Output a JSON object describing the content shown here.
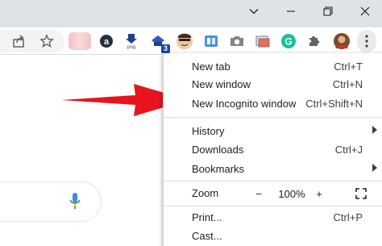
{
  "window_controls": {
    "dropdown_icon": "chevron-down-icon",
    "minimize_icon": "minimize-icon",
    "restore_icon": "restore-icon",
    "close_icon": "close-icon"
  },
  "toolbar": {
    "share_icon": "share-icon",
    "bookmark_icon": "star-icon",
    "extensions": [
      {
        "name": "amazon-assistant-icon"
      },
      {
        "name": "download-png-icon",
        "text": "png"
      },
      {
        "name": "extension-badge-icon",
        "badge": "3"
      },
      {
        "name": "avatar-extension-icon"
      },
      {
        "name": "reader-icon"
      },
      {
        "name": "camera-icon"
      },
      {
        "name": "screenshot-icon"
      },
      {
        "name": "grammarly-icon",
        "text": "G"
      },
      {
        "name": "puzzle-icon"
      },
      {
        "name": "profile-avatar"
      },
      {
        "name": "more-menu-icon"
      }
    ]
  },
  "menu": {
    "items": [
      {
        "label": "New tab",
        "shortcut": "Ctrl+T"
      },
      {
        "label": "New window",
        "shortcut": "Ctrl+N"
      },
      {
        "label": "New Incognito window",
        "shortcut": "Ctrl+Shift+N"
      },
      {
        "label": "History",
        "shortcut": ""
      },
      {
        "label": "Downloads",
        "shortcut": "Ctrl+J"
      },
      {
        "label": "Bookmarks",
        "shortcut": ""
      },
      {
        "label": "Zoom",
        "shortcut": ""
      },
      {
        "label": "Print...",
        "shortcut": "Ctrl+P"
      },
      {
        "label": "Cast...",
        "shortcut": ""
      }
    ],
    "zoom": {
      "minus": "−",
      "value": "100%",
      "plus": "+"
    }
  },
  "colors": {
    "arrow": "#e8141c",
    "titlebar": "#dfe3e8",
    "mic_blue": "#4285f4"
  }
}
